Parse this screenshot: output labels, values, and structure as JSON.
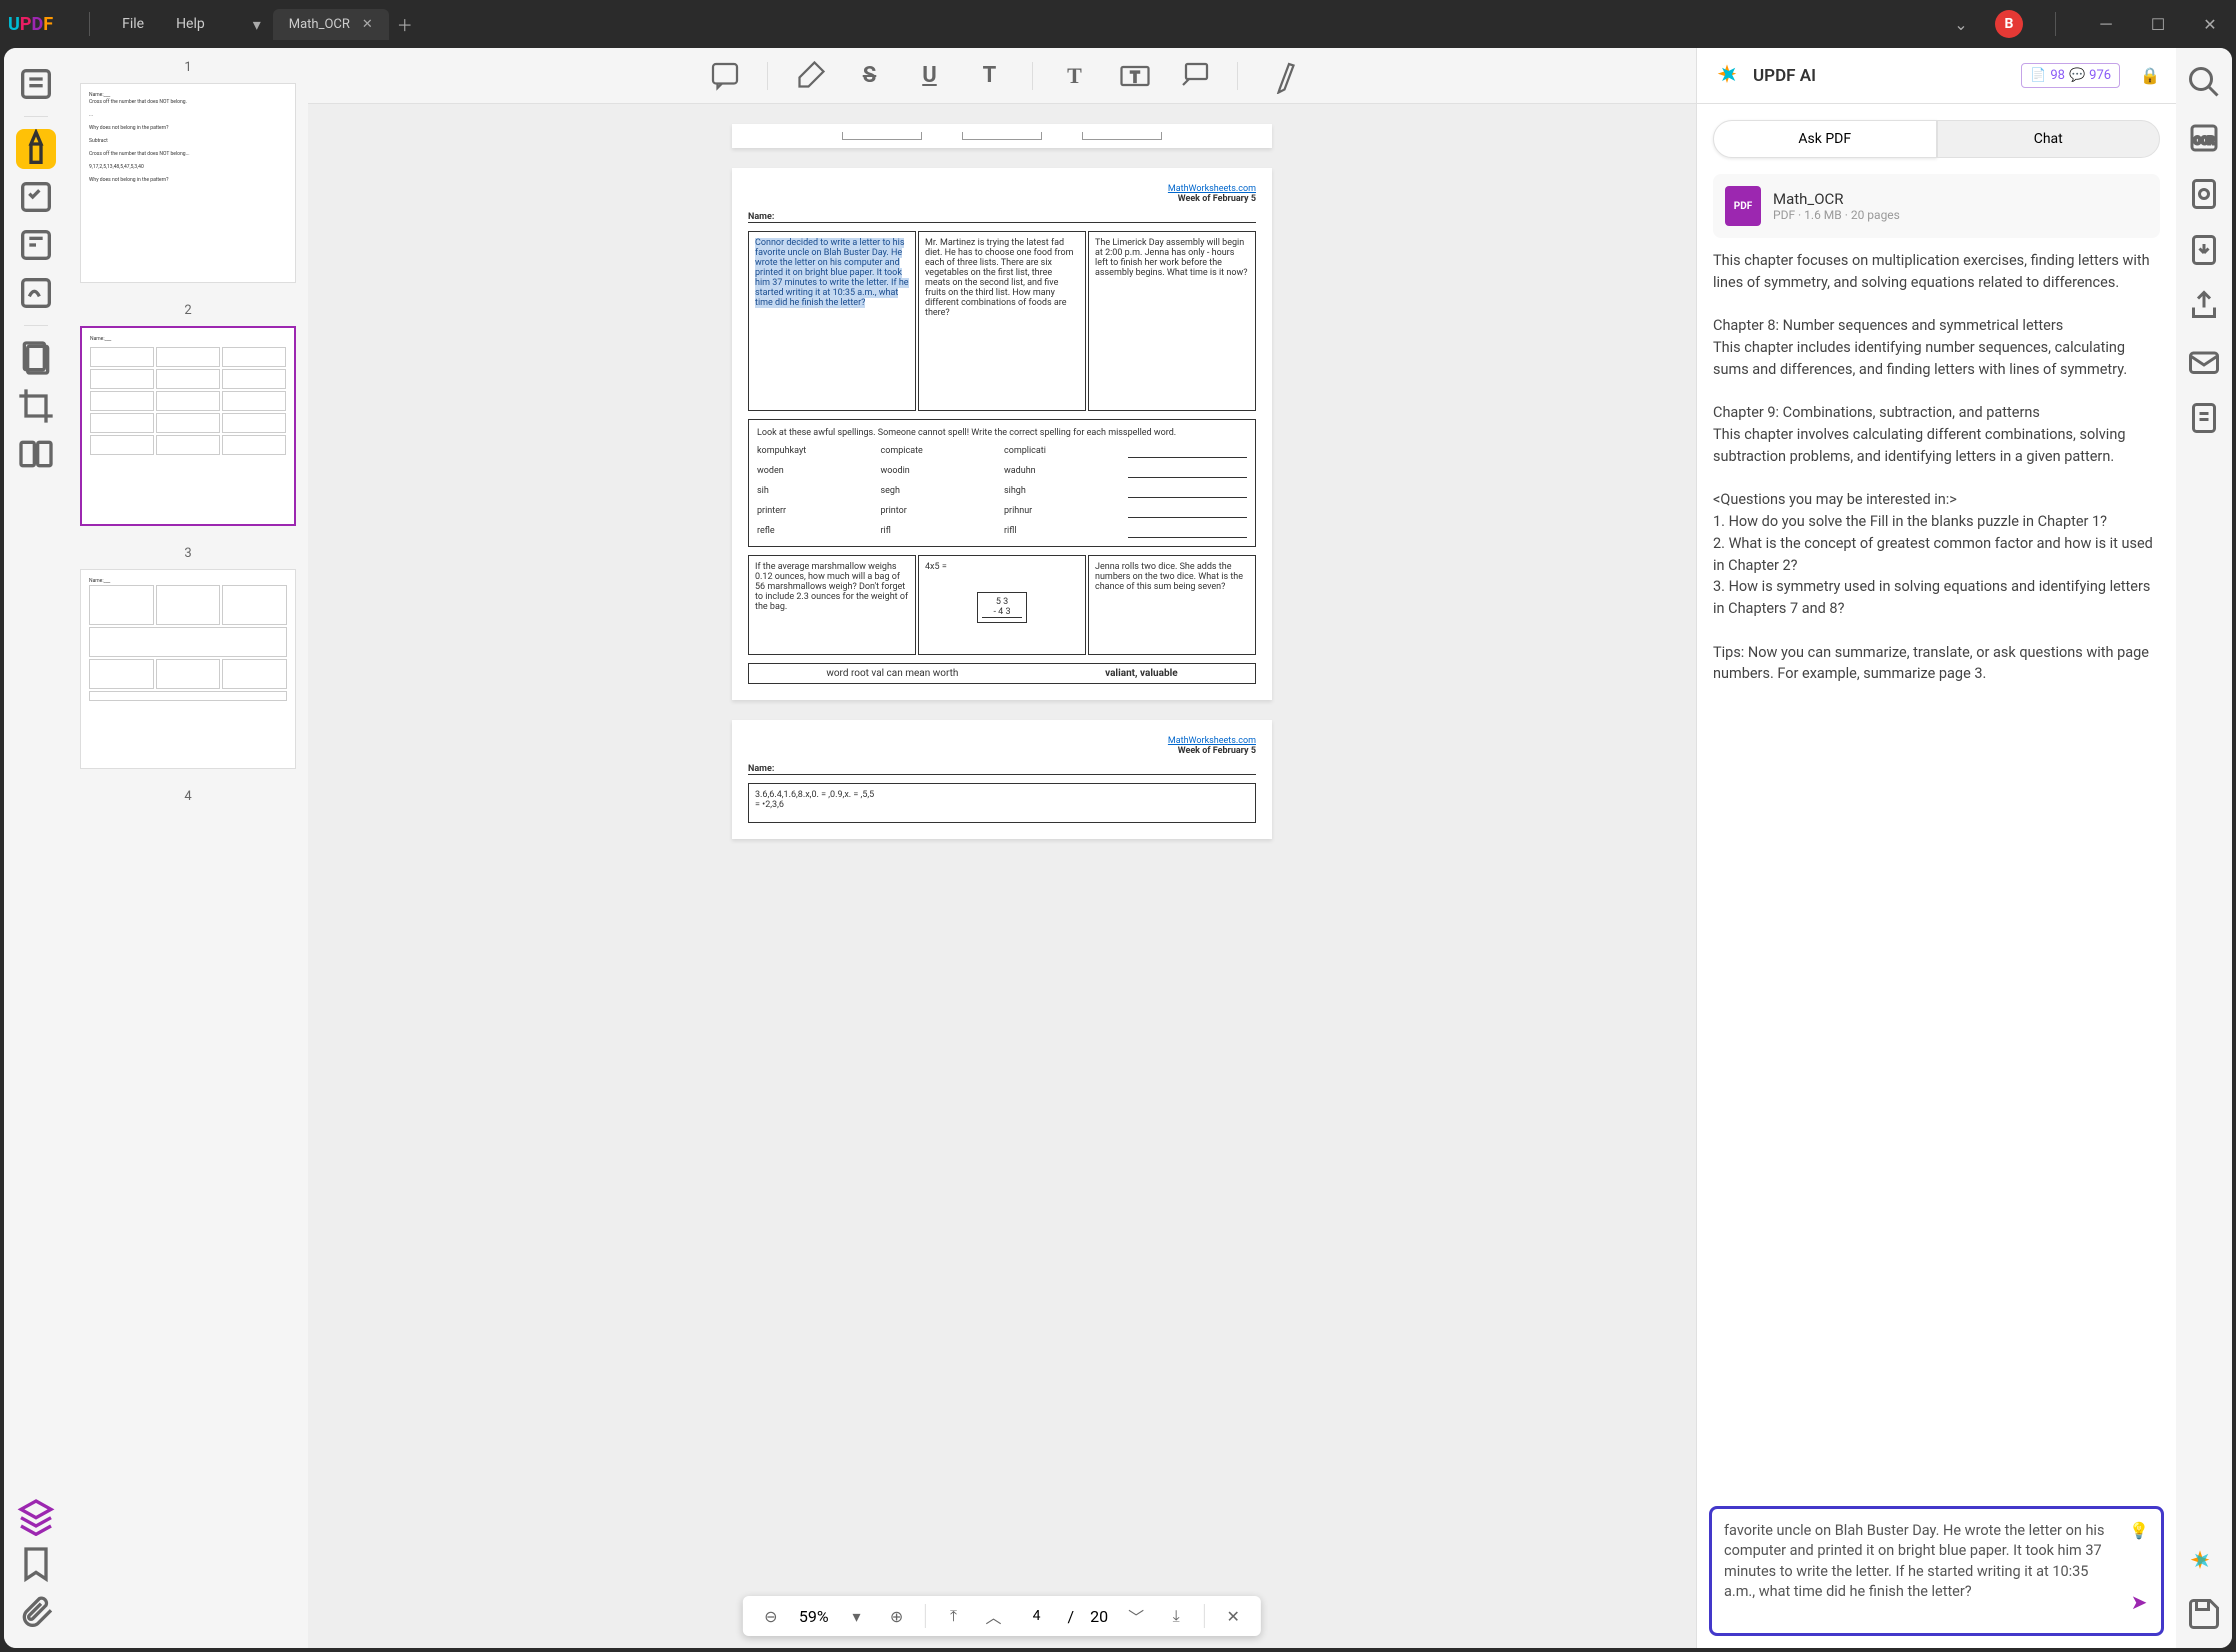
{
  "app": {
    "name": "UPDF"
  },
  "menu": {
    "file": "File",
    "help": "Help"
  },
  "tab": {
    "title": "Math_OCR"
  },
  "user": {
    "initial": "B"
  },
  "thumbnails": {
    "labels": [
      "1",
      "2",
      "3",
      "4"
    ]
  },
  "page_header": {
    "site": "MathWorksheets.com",
    "week": "Week of February 5",
    "name": "Name:"
  },
  "problems": {
    "box1": "Connor decided to write a letter to his favorite uncle on Blah Buster Day. He wrote the letter on his computer and printed it on bright blue paper. It took him 37 minutes to write the letter. If he started writing it at 10:35 a.m., what time did he finish the letter?",
    "box2": "Mr. Martinez is trying the latest fad diet. He has to choose one food from each of three lists. There are six vegetables on the first list, three meats on the second list, and five fruits on the third list. How many different combinations of foods are there?",
    "box3": "The Limerick Day assembly will begin at 2:00 p.m. Jenna has only - hours left to finish her work before the assembly begins. What time is it now?",
    "spell_instructions": "Look at these awful spellings. Someone cannot spell! Write the correct spelling for each misspelled word.",
    "spell_words": [
      [
        "kompuhkayt",
        "compicate",
        "complicati"
      ],
      [
        "woden",
        "woodin",
        "waduhn"
      ],
      [
        "sih",
        "segh",
        "sihgh"
      ],
      [
        "printerr",
        "printor",
        "prihnur"
      ],
      [
        "refle",
        "rifl",
        "rifll"
      ]
    ],
    "box4": "If the average marshmallow weighs 0.12 ounces, how much will a bag of 56 marshmallows weigh? Don't forget to include 2.3 ounces for the weight of the bag.",
    "box5_eq": "4x5 =",
    "box5_sub1": "5 3",
    "box5_sub2": "- 4 3",
    "box6": "Jenna rolls two dice. She adds the numbers on the two dice. What is the chance of this sum being seven?",
    "word_root": "word root val can mean worth",
    "word_root_ex": "valiant, valuable",
    "p2_eq": "3.6,6.4,1.6,8.x,0. = ,0.9,x. = ,5,5\n= •2,3,6"
  },
  "zoom": {
    "value": "59%"
  },
  "pages": {
    "current": "4",
    "total": "20"
  },
  "ai": {
    "title": "UPDF AI",
    "quota1": "98",
    "quota2": "976",
    "tab_ask": "Ask PDF",
    "tab_chat": "Chat",
    "file_name": "Math_OCR",
    "file_meta": "PDF · 1.6 MB · 20 pages",
    "content": "This chapter focuses on multiplication exercises, finding letters with lines of symmetry, and solving equations related to differences.\n\nChapter 8: Number sequences and symmetrical letters\nThis chapter includes identifying number sequences, calculating sums and differences, and finding letters with lines of symmetry.\n\nChapter 9: Combinations, subtraction, and patterns\nThis chapter involves calculating different combinations, solving subtraction problems, and identifying letters in a given pattern.\n\n<Questions you may be interested in:>\n1. How do you solve the Fill in the blanks puzzle in Chapter 1?\n2. What is the concept of greatest common factor and how is it used in Chapter 2?\n3. How is symmetry used in solving equations and identifying letters in Chapters 7 and 8?\n\nTips: Now you can summarize, translate, or ask questions with page numbers. For example, summarize page 3.",
    "input_text": "favorite uncle on Blah Buster Day. He wrote the letter on his computer and printed it on bright blue paper. It took him 37 minutes to write the letter. If he started writing it at 10:35 a.m., what time did he finish the letter?"
  }
}
